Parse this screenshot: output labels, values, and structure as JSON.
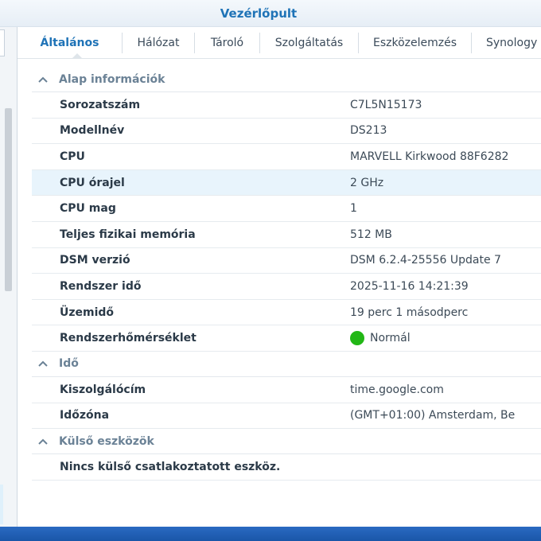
{
  "window": {
    "title": "Vezérlőpult"
  },
  "tabs": [
    {
      "label": "Általános",
      "active": true
    },
    {
      "label": "Hálózat"
    },
    {
      "label": "Tároló"
    },
    {
      "label": "Szolgáltatás"
    },
    {
      "label": "Eszközelemzés"
    },
    {
      "label": "Synology"
    }
  ],
  "sections": {
    "basic": {
      "title": "Alap információk",
      "rows": [
        {
          "key": "Sorozatszám",
          "value": "C7L5N15173"
        },
        {
          "key": "Modellnév",
          "value": "DS213"
        },
        {
          "key": "CPU",
          "value": "MARVELL Kirkwood 88F6282"
        },
        {
          "key": "CPU órajel",
          "value": "2 GHz"
        },
        {
          "key": "CPU mag",
          "value": "1"
        },
        {
          "key": "Teljes fizikai memória",
          "value": "512 MB"
        },
        {
          "key": "DSM verzió",
          "value": "DSM 6.2.4-25556 Update 7"
        },
        {
          "key": "Rendszer idő",
          "value": "2025-11-16 14:21:39"
        },
        {
          "key": "Üzemidő",
          "value": "19 perc 1 másodperc"
        },
        {
          "key": "Rendszerhőmérséklet",
          "value": "Normál"
        }
      ]
    },
    "time": {
      "title": "Idő",
      "rows": [
        {
          "key": "Kiszolgálócím",
          "value": "time.google.com"
        },
        {
          "key": "Időzóna",
          "value": "(GMT+01:00) Amsterdam, Be"
        }
      ]
    },
    "external": {
      "title": "Külső eszközök",
      "empty_message": "Nincs külső csatlakoztatott eszköz."
    }
  },
  "colors": {
    "accent": "#1f73b7",
    "status_ok": "#22b716",
    "highlight_row": "#e8f4fc"
  }
}
